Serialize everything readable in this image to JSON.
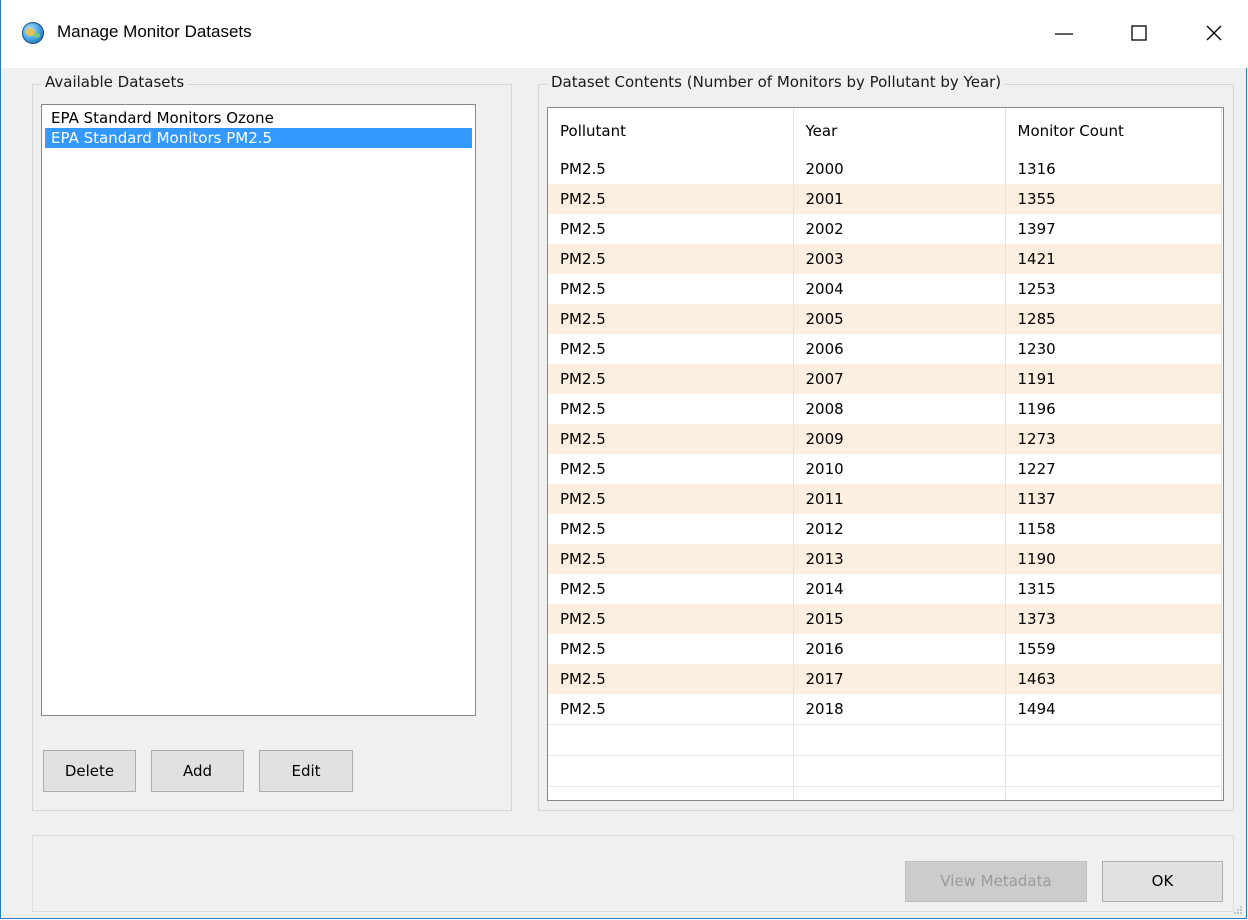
{
  "window": {
    "title": "Manage Monitor Datasets",
    "minimize_icon": "minimize-icon",
    "maximize_icon": "maximize-icon",
    "close_icon": "close-icon",
    "app_icon": "globe-icon"
  },
  "datasets_panel": {
    "legend": "Available Datasets",
    "items": [
      {
        "label": "EPA Standard Monitors Ozone",
        "selected": false
      },
      {
        "label": "EPA Standard Monitors PM2.5",
        "selected": true
      }
    ],
    "buttons": {
      "delete": "Delete",
      "add": "Add",
      "edit": "Edit"
    }
  },
  "contents_panel": {
    "legend": "Dataset Contents (Number of Monitors by Pollutant by Year)",
    "columns": [
      "Pollutant",
      "Year",
      "Monitor Count"
    ],
    "rows": [
      [
        "PM2.5",
        "2000",
        "1316"
      ],
      [
        "PM2.5",
        "2001",
        "1355"
      ],
      [
        "PM2.5",
        "2002",
        "1397"
      ],
      [
        "PM2.5",
        "2003",
        "1421"
      ],
      [
        "PM2.5",
        "2004",
        "1253"
      ],
      [
        "PM2.5",
        "2005",
        "1285"
      ],
      [
        "PM2.5",
        "2006",
        "1230"
      ],
      [
        "PM2.5",
        "2007",
        "1191"
      ],
      [
        "PM2.5",
        "2008",
        "1196"
      ],
      [
        "PM2.5",
        "2009",
        "1273"
      ],
      [
        "PM2.5",
        "2010",
        "1227"
      ],
      [
        "PM2.5",
        "2011",
        "1137"
      ],
      [
        "PM2.5",
        "2012",
        "1158"
      ],
      [
        "PM2.5",
        "2013",
        "1190"
      ],
      [
        "PM2.5",
        "2014",
        "1315"
      ],
      [
        "PM2.5",
        "2015",
        "1373"
      ],
      [
        "PM2.5",
        "2016",
        "1559"
      ],
      [
        "PM2.5",
        "2017",
        "1463"
      ],
      [
        "PM2.5",
        "2018",
        "1494"
      ]
    ]
  },
  "footer": {
    "view_metadata": "View Metadata",
    "ok": "OK"
  },
  "colors": {
    "selection": "#3399ff",
    "alt_row": "#fcefdf",
    "window_border": "#2b78c5"
  }
}
